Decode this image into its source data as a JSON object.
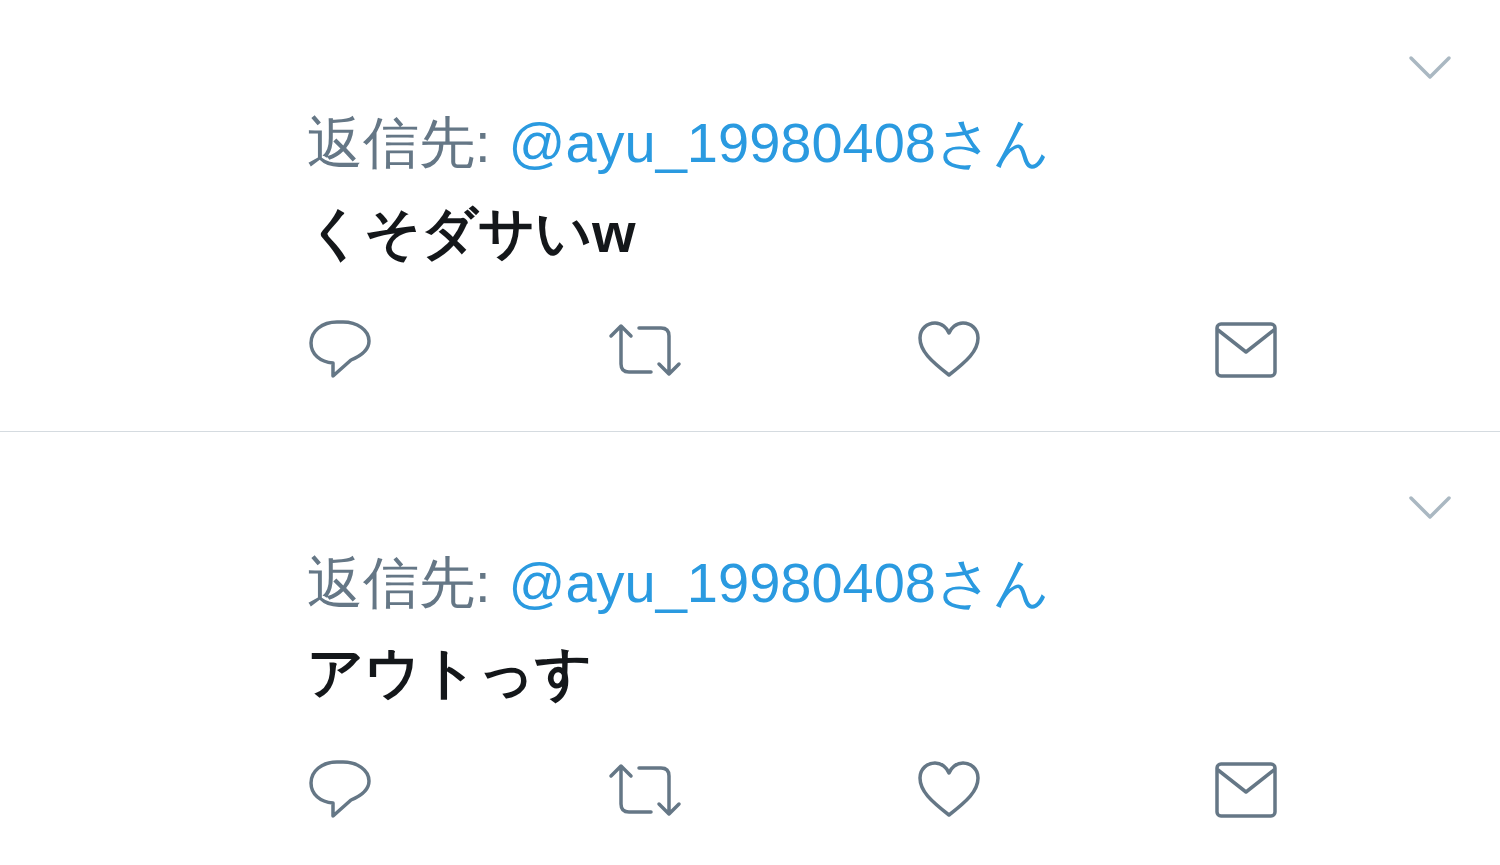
{
  "tweets": [
    {
      "reply_label": "返信先:",
      "reply_to": "@ayu_19980408さん",
      "text": "くそダサいw"
    },
    {
      "reply_label": "返信先:",
      "reply_to": "@ayu_19980408さん",
      "text": "アウトっす"
    }
  ]
}
